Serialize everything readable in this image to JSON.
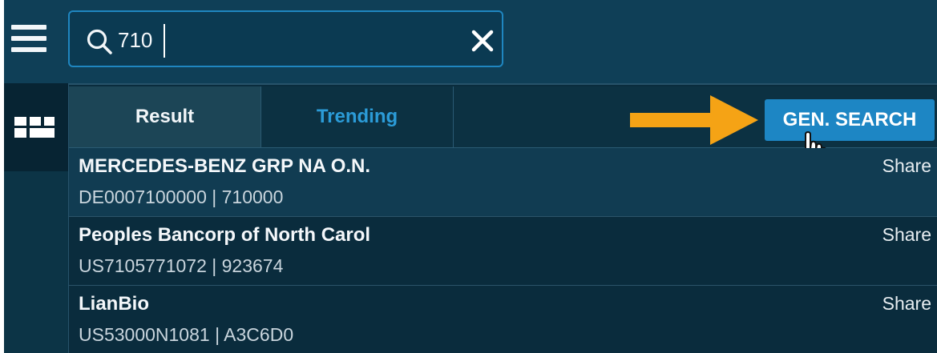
{
  "search": {
    "value": "710"
  },
  "tabs": [
    {
      "label": "Result",
      "active": true
    },
    {
      "label": "Trending",
      "active": false
    }
  ],
  "gen_search_label": "GEN. SEARCH",
  "results": [
    {
      "name": "MERCEDES-BENZ GRP NA O.N.",
      "ids": "DE0007100000 | 710000",
      "type": "Share",
      "selected": true
    },
    {
      "name": "Peoples Bancorp of North Carol",
      "ids": "US7105771072 | 923674",
      "type": "Share",
      "selected": false
    },
    {
      "name": "LianBio",
      "ids": "US53000N1081 | A3C6D0",
      "type": "Share",
      "selected": false
    }
  ],
  "icons": {
    "menu": "hamburger-menu-icon",
    "search": "search-icon",
    "clear": "close-icon",
    "tiles": "tiles-grid-icon",
    "annotation_arrow": "arrow-right-icon",
    "cursor": "hand-pointer-cursor-icon"
  },
  "colors": {
    "topbar": "#0f3f57",
    "dropdown": "#0a2c3d",
    "accent": "#1d86c4",
    "trending_text": "#2b9bd7",
    "arrow": "#f5a315"
  }
}
